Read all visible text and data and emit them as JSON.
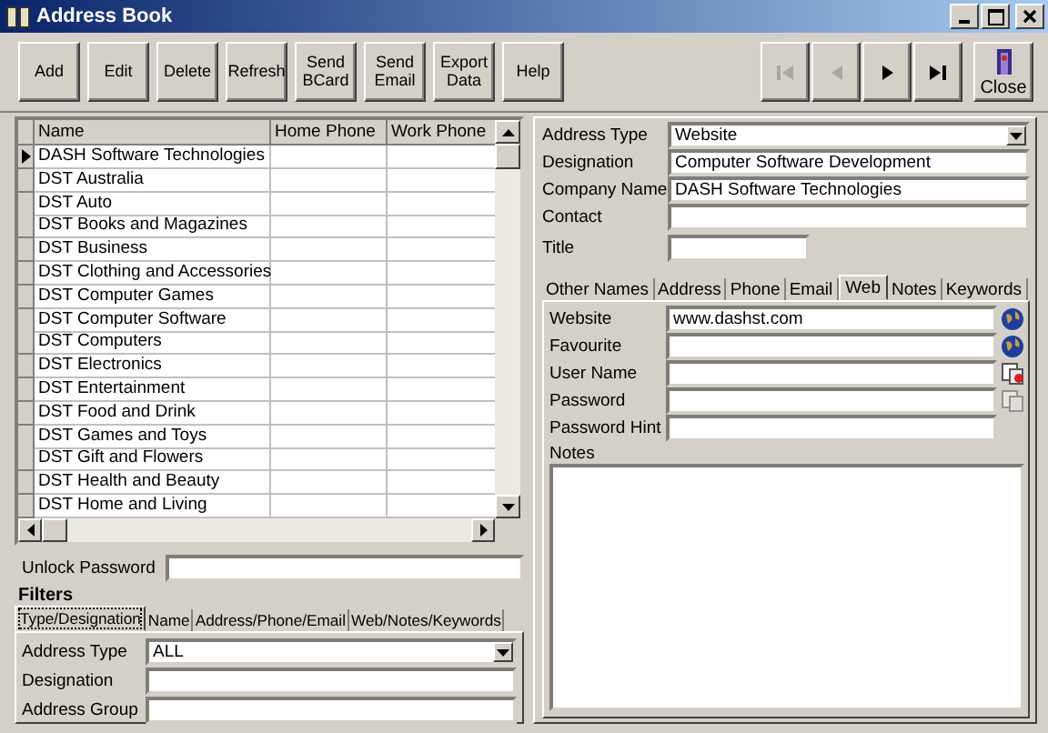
{
  "window": {
    "title": "Address Book"
  },
  "toolbar": {
    "buttons": [
      {
        "lines": [
          "Add"
        ]
      },
      {
        "lines": [
          "Edit"
        ]
      },
      {
        "lines": [
          "Delete"
        ]
      },
      {
        "lines": [
          "Refresh"
        ]
      },
      {
        "lines": [
          "Send",
          "BCard"
        ]
      },
      {
        "lines": [
          "Send",
          "Email"
        ]
      },
      {
        "lines": [
          "Export",
          "Data"
        ]
      },
      {
        "lines": [
          "Help"
        ]
      }
    ],
    "navigation": [
      {
        "kind": "first",
        "disabled": true
      },
      {
        "kind": "previous",
        "disabled": true
      },
      {
        "kind": "next",
        "disabled": false
      },
      {
        "kind": "last",
        "disabled": false
      }
    ],
    "close_button": {
      "label": "Close"
    }
  },
  "contacts_grid": {
    "columns": [
      "Name",
      "Home Phone",
      "Work Phone"
    ],
    "rows": [
      {
        "name": "DASH Software Technologies",
        "selected": true
      },
      {
        "name": "DST Australia",
        "selected": false
      },
      {
        "name": "DST Auto",
        "selected": false
      },
      {
        "name": "DST Books and Magazines",
        "selected": false
      },
      {
        "name": "DST Business",
        "selected": false
      },
      {
        "name": "DST Clothing and Accessories",
        "selected": false
      },
      {
        "name": "DST Computer Games",
        "selected": false
      },
      {
        "name": "DST Computer Software",
        "selected": false
      },
      {
        "name": "DST Computers",
        "selected": false
      },
      {
        "name": "DST Electronics",
        "selected": false
      },
      {
        "name": "DST Entertainment",
        "selected": false
      },
      {
        "name": "DST Food and Drink",
        "selected": false
      },
      {
        "name": "DST Games and Toys",
        "selected": false
      },
      {
        "name": "DST Gift and Flowers",
        "selected": false
      },
      {
        "name": "DST Health and Beauty",
        "selected": false
      },
      {
        "name": "DST Home and Living",
        "selected": false
      }
    ]
  },
  "unlock_password": {
    "label": "Unlock Password"
  },
  "filters": {
    "title": "Filters",
    "tabs": [
      {
        "label": "Type/Designation",
        "selected": true
      },
      {
        "label": "Name",
        "selected": false
      },
      {
        "label": "Address/Phone/Email",
        "selected": false
      },
      {
        "label": "Web/Notes/Keywords",
        "selected": false
      }
    ],
    "fields": [
      {
        "label": "Address Type",
        "value": "ALL",
        "kind": "dropdown"
      },
      {
        "label": "Designation",
        "kind": "text"
      },
      {
        "label": "Address Group",
        "kind": "text"
      }
    ]
  },
  "details": {
    "fields": [
      {
        "label": "Address Type",
        "value": "Website",
        "kind": "dropdown"
      },
      {
        "label": "Designation",
        "value": "Computer Software Development",
        "kind": "text"
      },
      {
        "label": "Company Name",
        "value": "DASH Software Technologies",
        "kind": "text"
      },
      {
        "label": "Contact",
        "kind": "text"
      },
      {
        "label": "Title",
        "kind": "short"
      }
    ],
    "tabs": [
      {
        "label": "Other Names",
        "selected": false
      },
      {
        "label": "Address",
        "selected": false
      },
      {
        "label": "Phone",
        "selected": false
      },
      {
        "label": "Email",
        "selected": false
      },
      {
        "label": "Web",
        "selected": true
      },
      {
        "label": "Notes",
        "selected": false
      },
      {
        "label": "Keywords",
        "selected": false
      }
    ],
    "web_fields": [
      {
        "label": "Website",
        "value": "www.dashst.com",
        "kind": "globe",
        "button_disabled": false
      },
      {
        "label": "Favourite",
        "kind": "globe",
        "button_disabled": false
      },
      {
        "label": "User Name",
        "kind": "card",
        "button_disabled": false
      },
      {
        "label": "Password",
        "kind": "card",
        "button_disabled": true
      },
      {
        "label": "Password Hint",
        "kind": "none"
      }
    ],
    "notes": {
      "label": "Notes"
    }
  }
}
